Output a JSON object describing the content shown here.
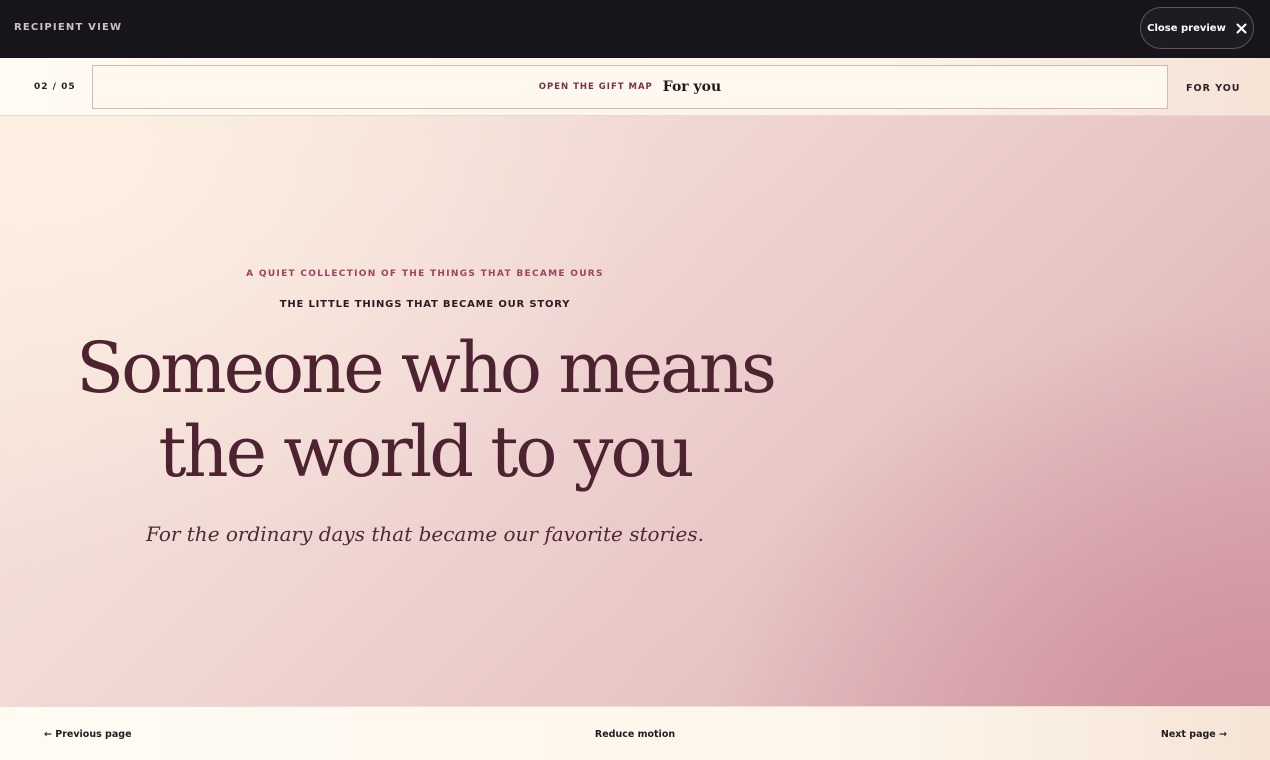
{
  "topbar": {
    "title": "RECIPIENT VIEW",
    "close_label": "Close preview"
  },
  "nav": {
    "page_counter": "02 / 05",
    "gift_map_label": "OPEN THE GIFT MAP",
    "gift_map_value": "For you",
    "for_you_label": "FOR YOU"
  },
  "hero": {
    "kicker": "A QUIET COLLECTION OF THE THINGS THAT BECAME OURS",
    "eyebrow": "THE LITTLE THINGS THAT BECAME OUR STORY",
    "headline_line1": "Someone who means",
    "headline_line2": "the world to you",
    "subline": "For the ordinary days that became our favorite stories."
  },
  "footer": {
    "prev_label": "← Previous page",
    "motion_label": "Reduce motion",
    "next_label": "Next page →"
  },
  "colors": {
    "topbar_bg": "#17151b",
    "accent": "#9b4460",
    "headline": "#4d2331"
  },
  "icons": {
    "close": "close-icon"
  }
}
